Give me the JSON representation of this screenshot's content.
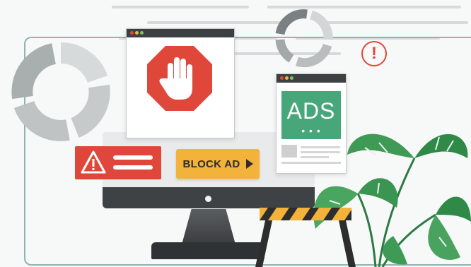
{
  "ads_window": {
    "title": "ADS",
    "dots": "• • •"
  },
  "block_button": {
    "label": "BLOCK AD"
  },
  "warning_circle": {
    "symbol": "!"
  },
  "colors": {
    "red": "#e0473b",
    "yellow": "#f3b23a",
    "green": "#47a67a",
    "dark": "#3d4043",
    "teal_frame": "#8fb5b0"
  },
  "icons": [
    "stop-hand-icon",
    "warning-triangle-icon",
    "exclamation-circle-icon",
    "arrow-right-icon"
  ]
}
